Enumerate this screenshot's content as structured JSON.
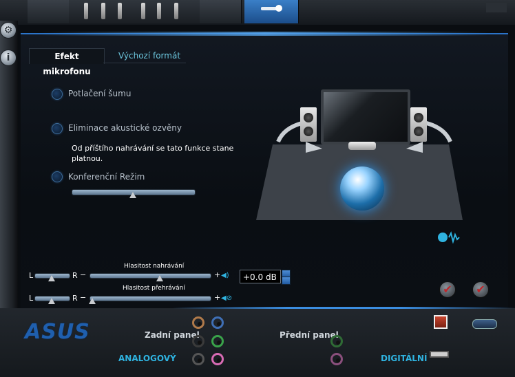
{
  "tabs": {
    "active": "Efekt mikrofonu",
    "inactive": "Výchozí formát"
  },
  "options": [
    {
      "label": "Potlačení šumu"
    },
    {
      "label": "Eliminace akustické ozvěny"
    },
    {
      "label": "Konferenční Režim"
    }
  ],
  "note": "Od příštího nahrávání se tato funkce stane platnou.",
  "volume": {
    "record_label": "Hlasitost nahrávání",
    "playback_label": "Hlasitost přehrávání",
    "left": "L",
    "right": "R",
    "db_value": "+0.0 dB",
    "record_level": 0.58,
    "playback_level": 0.02,
    "conference_level": 0.5
  },
  "bottom": {
    "logo": "ASUS",
    "rear_panel": "Zadní panel",
    "front_panel": "Přední panel",
    "analog": "ANALOGOVÝ",
    "digital": "DIGITÁLNÍ"
  },
  "colors": {
    "accent": "#2b74c9",
    "jack_orange": "#b07a4a",
    "jack_blue": "#3f6fb5",
    "jack_black": "#3a3a3a",
    "jack_green": "#3aa34a",
    "jack_pink": "#d86bb4",
    "jack_grey": "#8a8a8a"
  }
}
